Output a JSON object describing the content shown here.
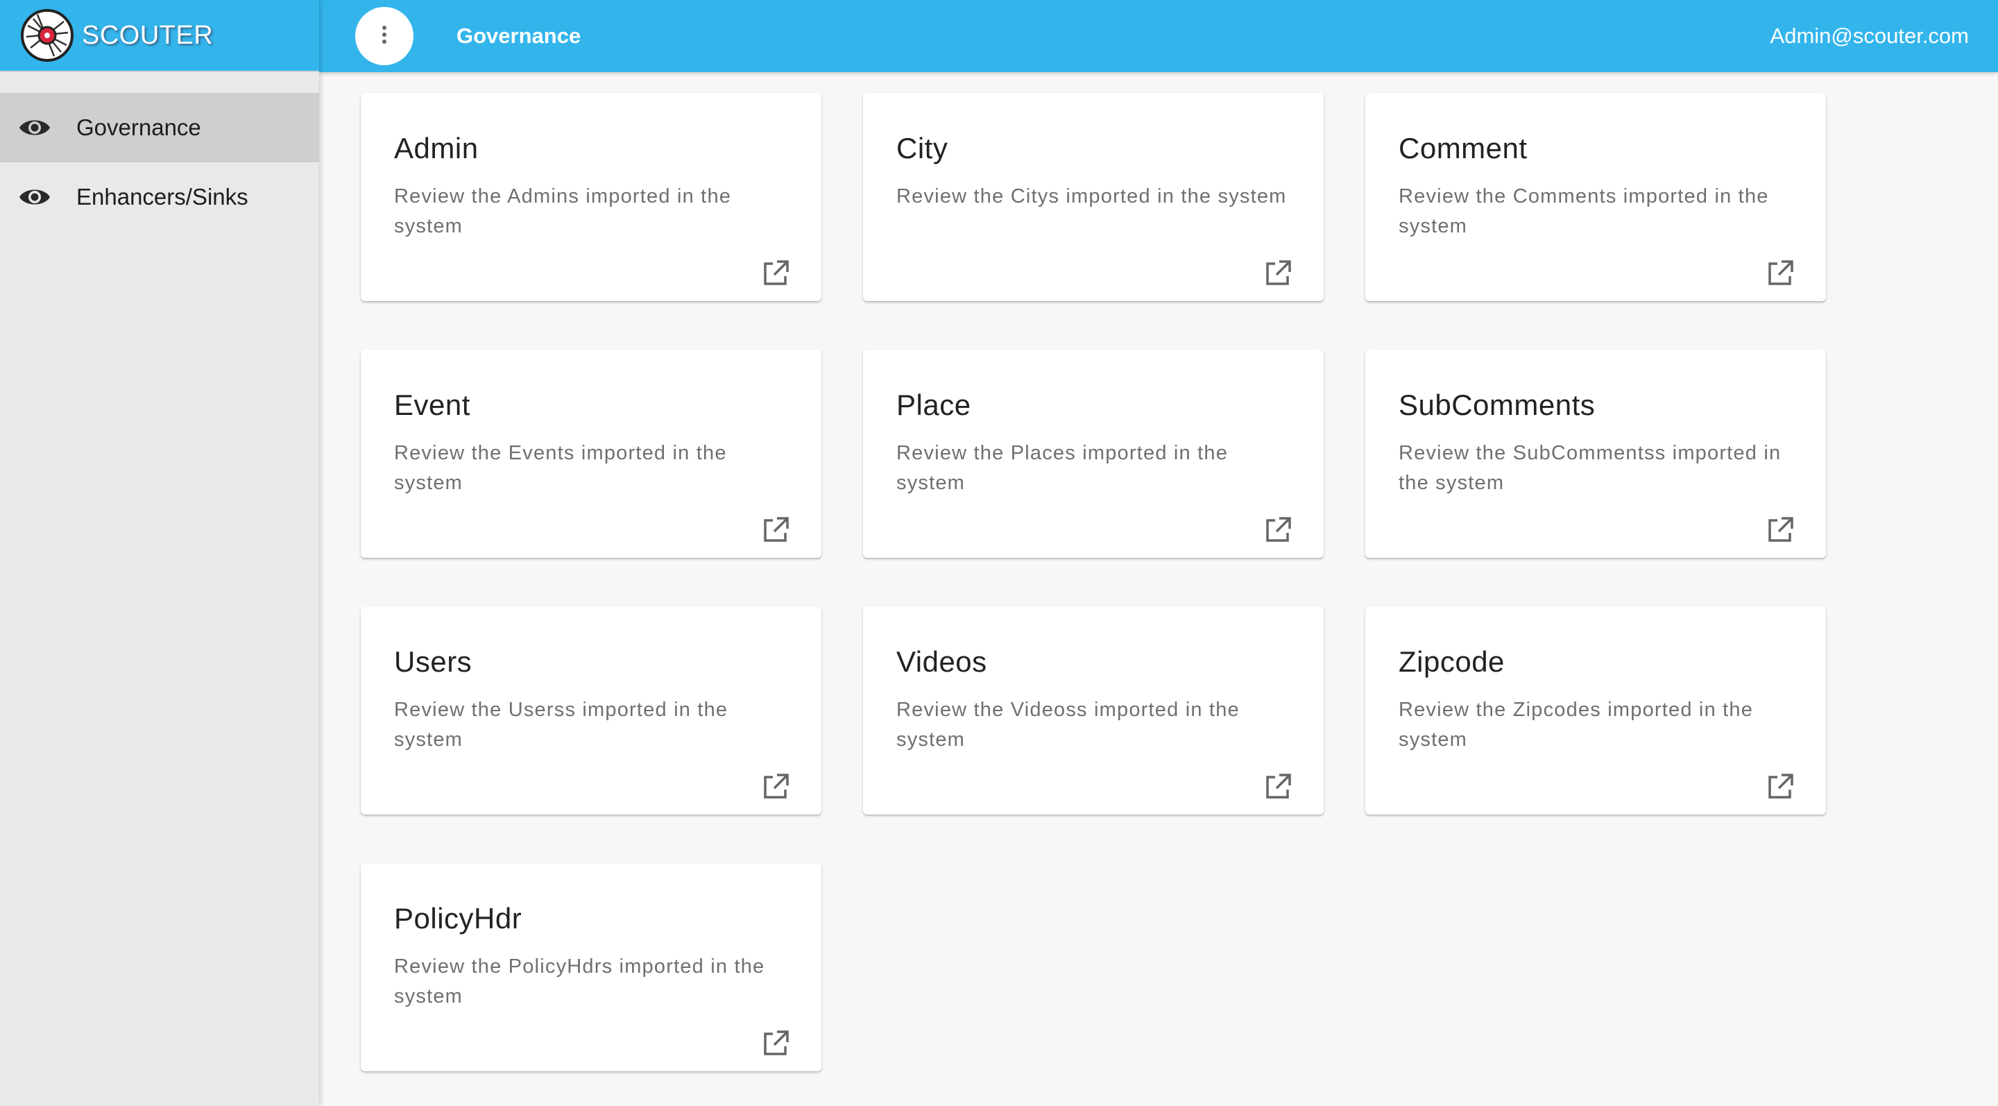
{
  "app": {
    "brand": "SCOUTER",
    "logo_icon": "scouter-logo-icon"
  },
  "colors": {
    "accent": "#33b5ec",
    "sidebar_bg": "#e9e9e9",
    "active_item_bg": "#cfcfcf",
    "page_bg": "#f7f7f7"
  },
  "sidebar": {
    "items": [
      {
        "label": "Governance",
        "icon": "eye-icon",
        "active": true
      },
      {
        "label": "Enhancers/Sinks",
        "icon": "eye-icon",
        "active": false
      }
    ]
  },
  "header": {
    "menu_icon": "more-vertical-icon",
    "title": "Governance",
    "user": "Admin@scouter.com"
  },
  "cards": [
    {
      "title": "Admin",
      "description": "Review the Admins imported in the system",
      "icon": "open-in-new-icon"
    },
    {
      "title": "City",
      "description": "Review the Citys imported in the system",
      "icon": "open-in-new-icon"
    },
    {
      "title": "Comment",
      "description": "Review the Comments imported in the system",
      "icon": "open-in-new-icon"
    },
    {
      "title": "Event",
      "description": "Review the Events imported in the system",
      "icon": "open-in-new-icon"
    },
    {
      "title": "Place",
      "description": "Review the Places imported in the system",
      "icon": "open-in-new-icon"
    },
    {
      "title": "SubComments",
      "description": "Review the SubCommentss imported in the system",
      "icon": "open-in-new-icon"
    },
    {
      "title": "Users",
      "description": "Review the Userss imported in the system",
      "icon": "open-in-new-icon"
    },
    {
      "title": "Videos",
      "description": "Review the Videoss imported in the system",
      "icon": "open-in-new-icon"
    },
    {
      "title": "Zipcode",
      "description": "Review the Zipcodes imported in the system",
      "icon": "open-in-new-icon"
    },
    {
      "title": "PolicyHdr",
      "description": "Review the PolicyHdrs imported in the system",
      "icon": "open-in-new-icon"
    }
  ]
}
